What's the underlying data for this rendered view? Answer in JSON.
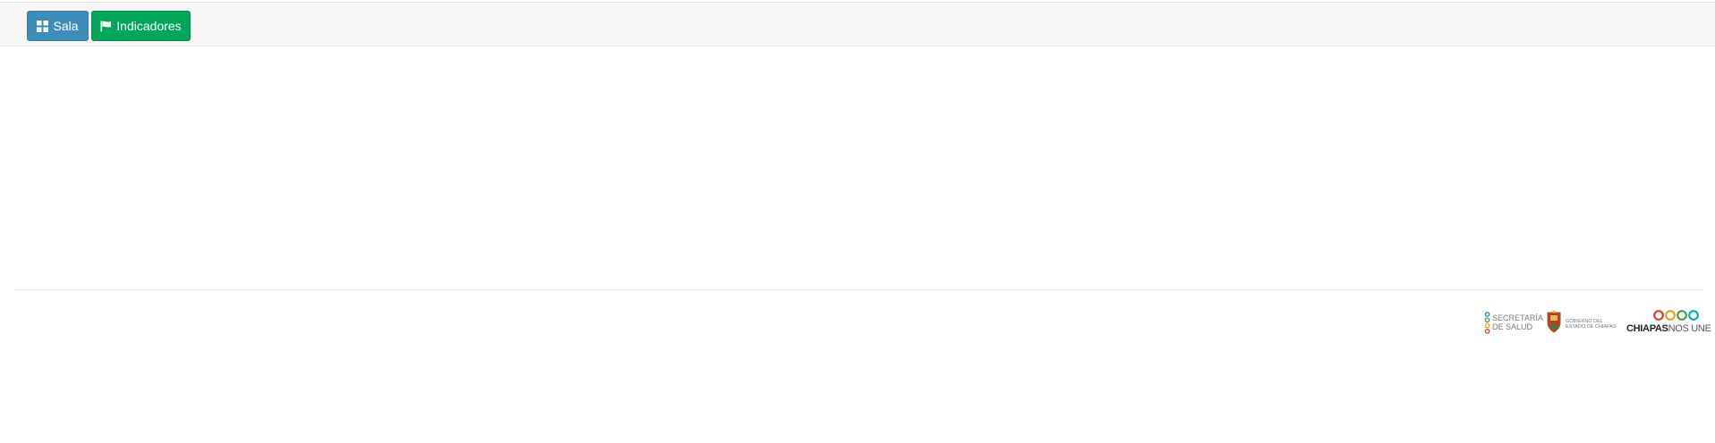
{
  "toolbar": {
    "sala_label": "Sala",
    "sala_icon": "grid-icon",
    "indicadores_label": "Indicadores",
    "indicadores_icon": "flag-icon"
  },
  "footer": {
    "logos": {
      "secretaria_line1": "SECRETARÍA",
      "secretaria_line2": "DE SALUD",
      "gobierno_line1": "GOBIERNO DEL",
      "gobierno_line2": "ESTADO DE CHIAPAS",
      "chiapas_bold": "CHIAPAS",
      "chiapas_light": "NOS UNE"
    }
  },
  "colors": {
    "primary": "#3c8dbc",
    "success": "#00a65a",
    "logo_red": "#e53935",
    "logo_orange": "#f39c12",
    "logo_green": "#43a047",
    "logo_blue": "#1e88e5",
    "logo_teal": "#00acc1"
  }
}
